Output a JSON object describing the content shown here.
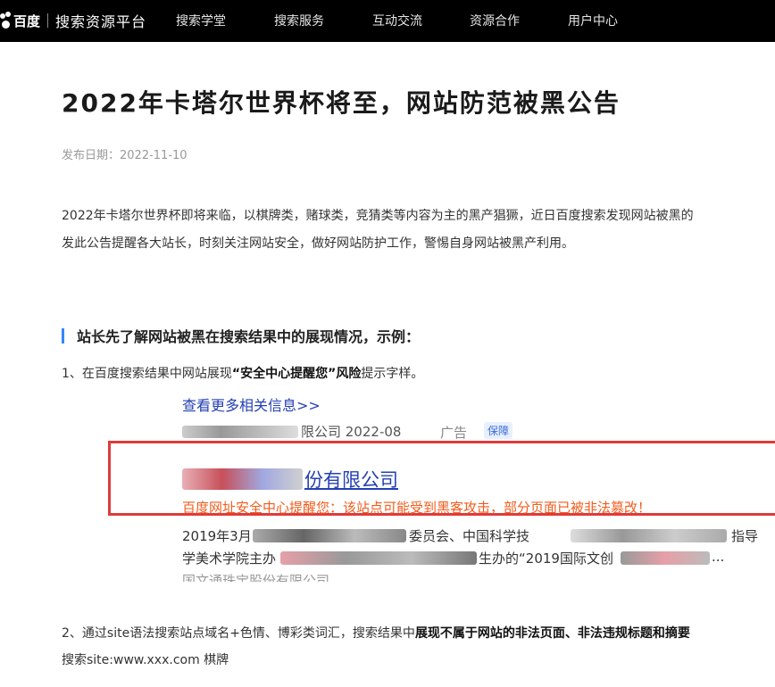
{
  "header": {
    "logo_text": "百度",
    "platform_name": "搜索资源平台",
    "nav": [
      "搜索学堂",
      "搜索服务",
      "互动交流",
      "资源合作",
      "用户中心"
    ]
  },
  "article": {
    "title": "2022年卡塔尔世界杯将至，网站防范被黑公告",
    "date": "发布日期：2022-11-10",
    "para1_line1": "2022年卡塔尔世界杯即将来临，以棋牌类，赌球类，竞猜类等内容为主的黑产猖獗，近日百度搜索发现网站被黑的",
    "para1_line2": "发此公告提醒各大站长，时刻关注网站安全，做好网站防护工作，警惕自身网站被黑产利用。",
    "section_title": "站长先了解网站被黑在搜索结果中的展现情况，示例：",
    "step1_pre": "1、在百度搜索结果中网站展现",
    "step1_bold": "“安全中心提醒您”风险",
    "step1_post": "提示字样。",
    "step2_pre": "2、通过site语法搜索站点域名+色情、博彩类词汇，搜索结果中",
    "step2_bold": "展现不属于网站的非法页面、非法违规标题和摘要",
    "step2_line2": "搜索site:www.xxx.com 棋牌"
  },
  "screenshot": {
    "more_link": "查看更多相关信息>>",
    "meta_suffix": "限公司 2022-08",
    "ad_label": "广告",
    "badge": "保障",
    "result_title_suffix": "份有限公司",
    "warning": "百度网址安全中心提醒您：该站点可能受到黑客攻击，部分页面已被非法篡改！",
    "line1_a": "2019年3月",
    "line1_b": "委员会、中国科学技",
    "line1_c": "指导",
    "line2_a": "学美术学院主办",
    "line2_b": "生办的“2019国际文创",
    "line2_c": "...",
    "line3": "国文通珠宝股份有限公司"
  },
  "colors": {
    "header_bg": "#000000",
    "accent": "#3385ff",
    "link": "#2440b3",
    "warning": "#f25b1b",
    "highlight_border": "#e03a3a"
  }
}
